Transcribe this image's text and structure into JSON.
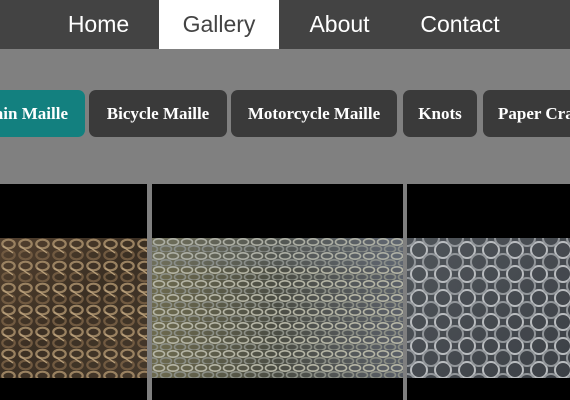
{
  "nav": {
    "items": [
      {
        "label": "Home"
      },
      {
        "label": "Gallery"
      },
      {
        "label": "About"
      },
      {
        "label": "Contact"
      }
    ],
    "active": "Gallery"
  },
  "categories": {
    "items": [
      {
        "label": "Chain Maille"
      },
      {
        "label": "Bicycle Maille"
      },
      {
        "label": "Motorcycle Maille"
      },
      {
        "label": "Knots"
      },
      {
        "label": "Paper Crafts"
      }
    ],
    "active": "Chain Maille"
  },
  "gallery": {
    "images": [
      {
        "name": "twisted-chain-maille-image"
      },
      {
        "name": "european-weave-maille-image"
      },
      {
        "name": "japanese-weave-maille-image"
      }
    ]
  },
  "colors": {
    "nav_background": "#434343",
    "page_background": "#808080",
    "button_background": "#3a3a3a",
    "active_button": "#13807f",
    "tile_background": "#000000"
  }
}
